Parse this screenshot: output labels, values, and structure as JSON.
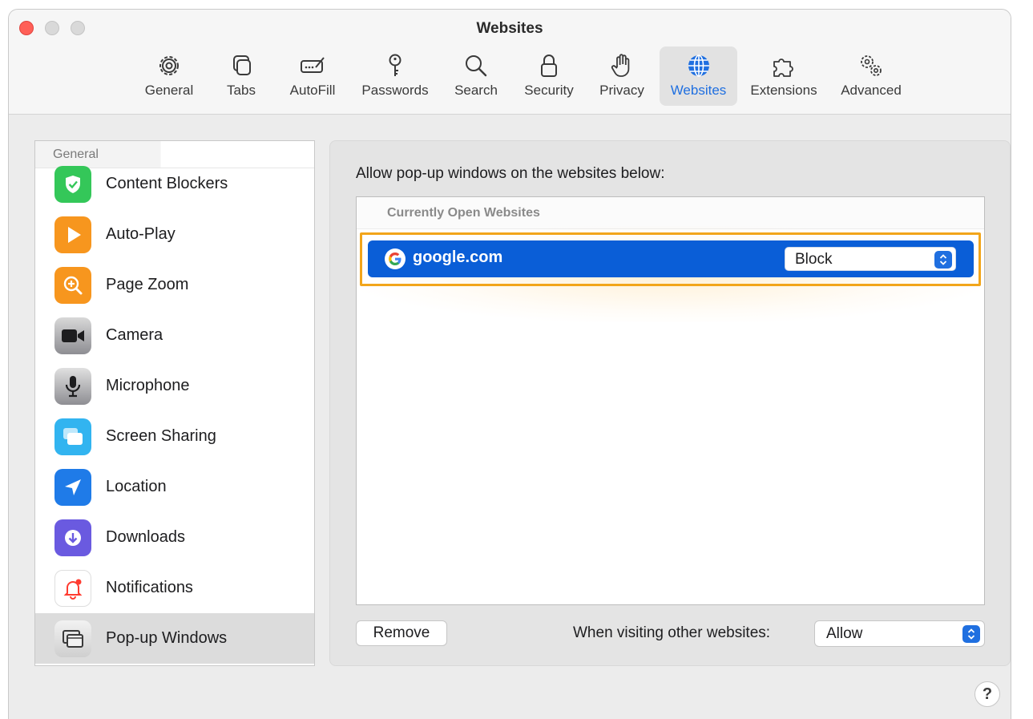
{
  "window": {
    "title": "Websites"
  },
  "toolbar": {
    "items": [
      {
        "label": "General",
        "icon": "gear-icon"
      },
      {
        "label": "Tabs",
        "icon": "tabs-icon"
      },
      {
        "label": "AutoFill",
        "icon": "autofill-icon"
      },
      {
        "label": "Passwords",
        "icon": "key-icon"
      },
      {
        "label": "Search",
        "icon": "search-icon"
      },
      {
        "label": "Security",
        "icon": "lock-icon"
      },
      {
        "label": "Privacy",
        "icon": "hand-icon"
      },
      {
        "label": "Websites",
        "icon": "globe-icon",
        "active": true
      },
      {
        "label": "Extensions",
        "icon": "puzzle-icon"
      },
      {
        "label": "Advanced",
        "icon": "gears-icon"
      }
    ]
  },
  "sidebar": {
    "header": "General",
    "items": [
      {
        "label": "Content Blockers",
        "icon": "shield-check-icon",
        "color": "#34c759"
      },
      {
        "label": "Auto-Play",
        "icon": "play-icon",
        "color": "#f7961e"
      },
      {
        "label": "Page Zoom",
        "icon": "zoom-icon",
        "color": "#f7961e"
      },
      {
        "label": "Camera",
        "icon": "camera-icon",
        "color": "#8e8e93"
      },
      {
        "label": "Microphone",
        "icon": "microphone-icon",
        "color": "#8e8e93"
      },
      {
        "label": "Screen Sharing",
        "icon": "screen-sharing-icon",
        "color": "#32b4f0"
      },
      {
        "label": "Location",
        "icon": "location-arrow-icon",
        "color": "#1f7be8"
      },
      {
        "label": "Downloads",
        "icon": "download-icon",
        "color": "#6a5ae0"
      },
      {
        "label": "Notifications",
        "icon": "bell-icon",
        "color": "#ffffff"
      },
      {
        "label": "Pop-up Windows",
        "icon": "popup-windows-icon",
        "color": "#d9d9d9",
        "selected": true
      }
    ]
  },
  "panel": {
    "description": "Allow pop-up windows on the websites below:",
    "table_header": "Currently Open Websites",
    "rows": [
      {
        "site": "google.com",
        "setting": "Block"
      }
    ],
    "remove_label": "Remove",
    "other_label": "When visiting other websites:",
    "other_value": "Allow"
  },
  "help": {
    "label": "?"
  },
  "colors": {
    "accent": "#0a5ed7",
    "highlight": "#f2a51a",
    "close": "#ff5f57"
  }
}
